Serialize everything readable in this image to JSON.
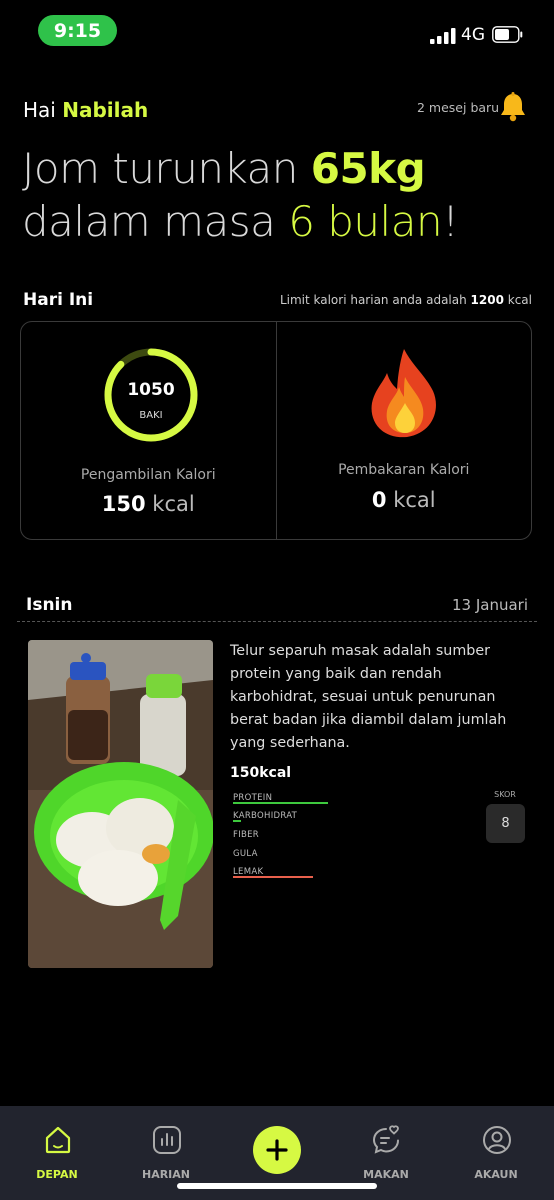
{
  "status": {
    "time": "9:15",
    "network": "4G"
  },
  "header": {
    "greeting": "Hai",
    "name": "Nabilah",
    "messages": "2 mesej baru"
  },
  "headline": {
    "line1_pre": "Jom turunkan ",
    "target_weight": "65kg",
    "line2_pre": "dalam masa ",
    "duration": "6 bulan",
    "line2_post": "!"
  },
  "today": {
    "title": "Hari Ini",
    "limit_text": "Limit kalori harian anda adalah ",
    "limit_value": "1200",
    "limit_unit": " kcal",
    "remaining_value": "1050",
    "remaining_label": "BAKI",
    "intake_label": "Pengambilan Kalori",
    "intake_value": "150",
    "intake_unit": " kcal",
    "burn_label": "Pembakaran Kalori",
    "burn_value": "0",
    "burn_unit": " kcal",
    "ring_progress": 0.875
  },
  "meal": {
    "day": "Isnin",
    "date": "13 Januari",
    "description": "Telur separuh masak adalah sumber protein yang baik dan rendah karbohidrat, sesuai untuk penurunan berat badan jika diambil dalam jumlah yang sederhana.",
    "kcal": "150kcal",
    "nutrients": [
      {
        "label": "PROTEIN",
        "level": 0.9,
        "color": "#3ec93e"
      },
      {
        "label": "KARBOHIDRAT",
        "level": 0.08,
        "color": "#3ec93e"
      },
      {
        "label": "FIBER",
        "level": 0,
        "color": "#3ec93e"
      },
      {
        "label": "GULA",
        "level": 0,
        "color": "#3ec93e"
      },
      {
        "label": "LEMAK",
        "level": 0.76,
        "color": "#e8604c"
      }
    ],
    "score_label": "SKOR",
    "score": "8"
  },
  "tabs": [
    {
      "label": "DEPAN",
      "icon": "home-icon"
    },
    {
      "label": "HARIAN",
      "icon": "chart-icon"
    },
    {
      "label": "MAKAN",
      "icon": "chat-heart-icon"
    },
    {
      "label": "AKAUN",
      "icon": "user-icon"
    }
  ],
  "colors": {
    "accent": "#d6f943",
    "background": "#000000",
    "tabbar": "#22242e"
  }
}
